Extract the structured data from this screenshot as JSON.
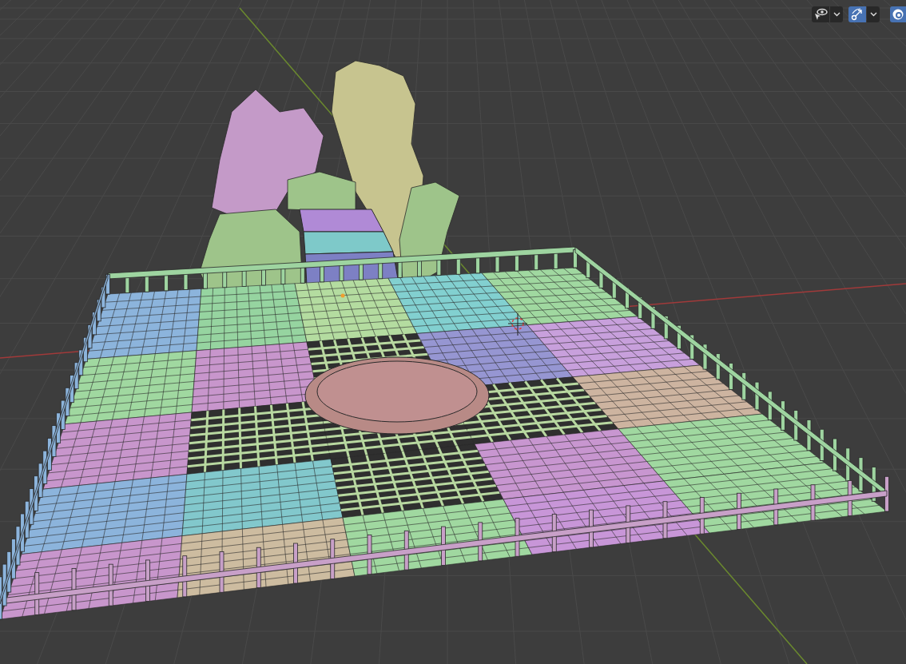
{
  "viewport": {
    "toolbar": [
      {
        "kind": "visibility",
        "selected": false
      },
      {
        "kind": "gizmo",
        "selected": true
      },
      {
        "kind": "overlay",
        "selected": true
      }
    ]
  }
}
